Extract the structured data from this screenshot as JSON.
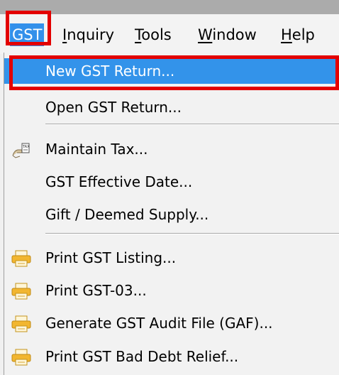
{
  "menubar": {
    "items": [
      {
        "key": "G",
        "rest": "ST",
        "active": true
      },
      {
        "key": "I",
        "rest": "nquiry"
      },
      {
        "key": "T",
        "rest": "ools"
      },
      {
        "key": "W",
        "rest": "indow"
      },
      {
        "key": "H",
        "rest": "elp"
      }
    ]
  },
  "menu": {
    "items": [
      {
        "label": "New GST Return...",
        "highlighted": true
      },
      {
        "label": "Open GST Return..."
      },
      {
        "label": "Maintain Tax...",
        "icon": "maintain-tax-icon"
      },
      {
        "label": "GST Effective Date..."
      },
      {
        "label": "Gift / Deemed Supply..."
      },
      {
        "label": "Print GST Listing...",
        "icon": "printer-icon"
      },
      {
        "label": "Print GST-03...",
        "icon": "printer-icon"
      },
      {
        "label": "Generate GST Audit File (GAF)...",
        "icon": "printer-icon"
      },
      {
        "label": "Print GST Bad Debt Relief...",
        "icon": "printer-icon"
      }
    ]
  },
  "colors": {
    "highlight": "#3393ea",
    "annotation": "#e30000",
    "printer": "#f2b630"
  }
}
